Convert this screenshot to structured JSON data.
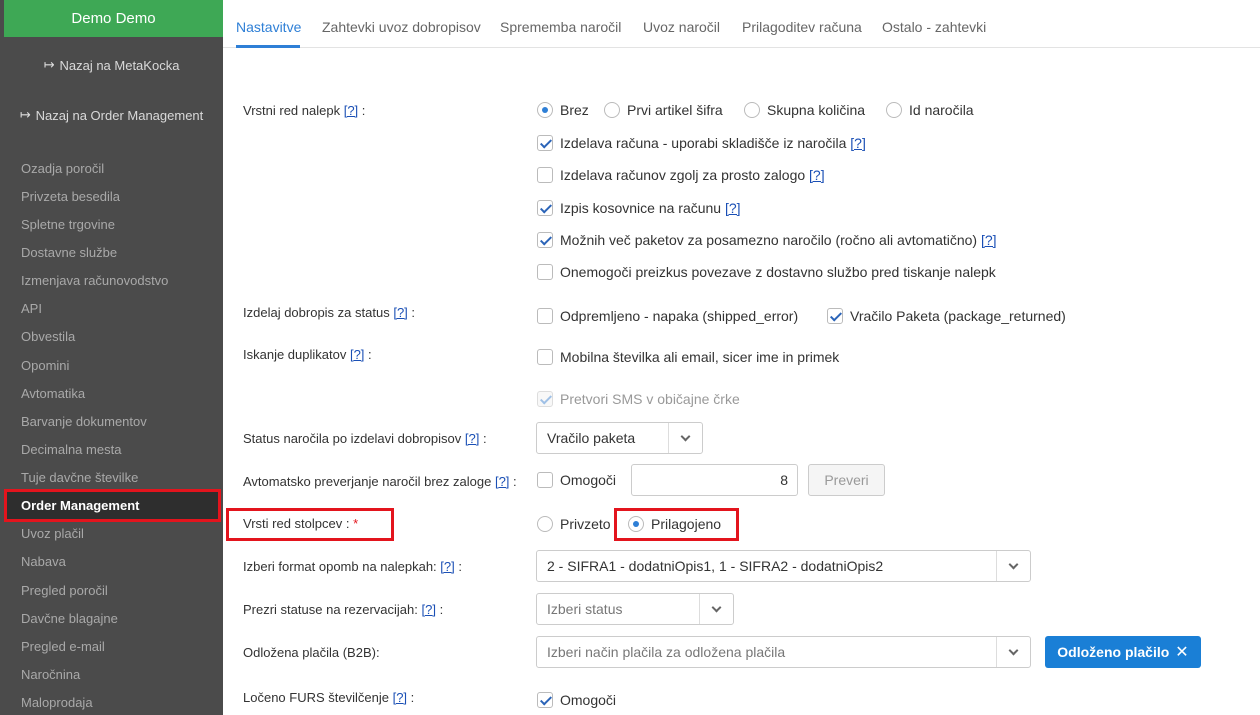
{
  "sidebar": {
    "brand": "Demo Demo",
    "back_metakocka": "Nazaj na MetaKocka",
    "back_order_mgmt": "Nazaj na Order Management",
    "items": [
      "Ozadja poročil",
      "Privzeta besedila",
      "Spletne trgovine",
      "Dostavne službe",
      "Izmenjava računovodstvo",
      "API",
      "Obvestila",
      "Opomini",
      "Avtomatika",
      "Barvanje dokumentov",
      "Decimalna mesta",
      "Tuje davčne številke",
      "Order Management",
      "Uvoz plačil",
      "Nabava",
      "Pregled poročil",
      "Davčne blagajne",
      "Pregled e-mail",
      "Naročnina",
      "Maloprodaja"
    ]
  },
  "tabs": [
    "Nastavitve",
    "Zahtevki uvoz dobropisov",
    "Sprememba naročil",
    "Uvoz naročil",
    "Prilagoditev računa",
    "Ostalo - zahtevki"
  ],
  "help": "[?]",
  "form": {
    "label_order": "Vrstni red nalepk",
    "order_options": [
      "Brez",
      "Prvi artikel šifra",
      "Skupna količina",
      "Id naročila"
    ],
    "cb_invoice_warehouse": "Izdelava računa - uporabi skladišče iz naročila",
    "cb_invoice_stock_only": "Izdelava računov zgolj za prosto zalogo",
    "cb_bom_print": "Izpis kosovnice na računu",
    "cb_multi_packages": "Možnih več paketov za posamezno naročilo (ročno ali avtomatično)",
    "cb_disable_check": "Onemogoči preizkus povezave z dostavno službo pred tiskanje nalepk",
    "label_credit_status": "Izdelaj dobropis za status",
    "cb_shipped_error": "Odpremljeno - napaka (shipped_error)",
    "cb_package_returned": "Vračilo Paketa (package_returned)",
    "label_duplicates": "Iskanje duplikatov",
    "cb_mobile_email": "Mobilna številka ali email, sicer ime in primek",
    "cb_sms": "Pretvori SMS v običajne črke",
    "label_status_after_credit": "Status naročila po izdelavi dobropisov",
    "status_after_credit_value": "Vračilo paketa",
    "label_auto_check": "Avtomatsko preverjanje naročil brez zaloge",
    "cb_enable": "Omogoči",
    "auto_check_number": "8",
    "btn_check": "Preveri",
    "label_column_order": "Vrsti red stolpcev :",
    "required_mark": "*",
    "radio_default": "Privzeto",
    "radio_custom": "Prilagojeno",
    "label_note_format": "Izberi format opomb na nalepkah:",
    "note_format_value": "2 - SIFRA1 - dodatniOpis1, 1 - SIFRA2 - dodatniOpis2",
    "label_ignore_status": "Prezri statuse na rezervacijah:",
    "ignore_status_placeholder": "Izberi status",
    "label_deferred": "Odložena plačila (B2B):",
    "deferred_placeholder": "Izberi način plačila za odložena plačila",
    "deferred_tag": "Odloženo plačilo",
    "label_furs": "Ločeno FURS številčenje",
    "cb_furs_enable": "Omogoči"
  },
  "colors": {
    "accent": "#2e7fd6",
    "brand_green": "#3ea855",
    "highlight_red": "#e3141d",
    "sidebar_bg": "#4b4b4b"
  }
}
